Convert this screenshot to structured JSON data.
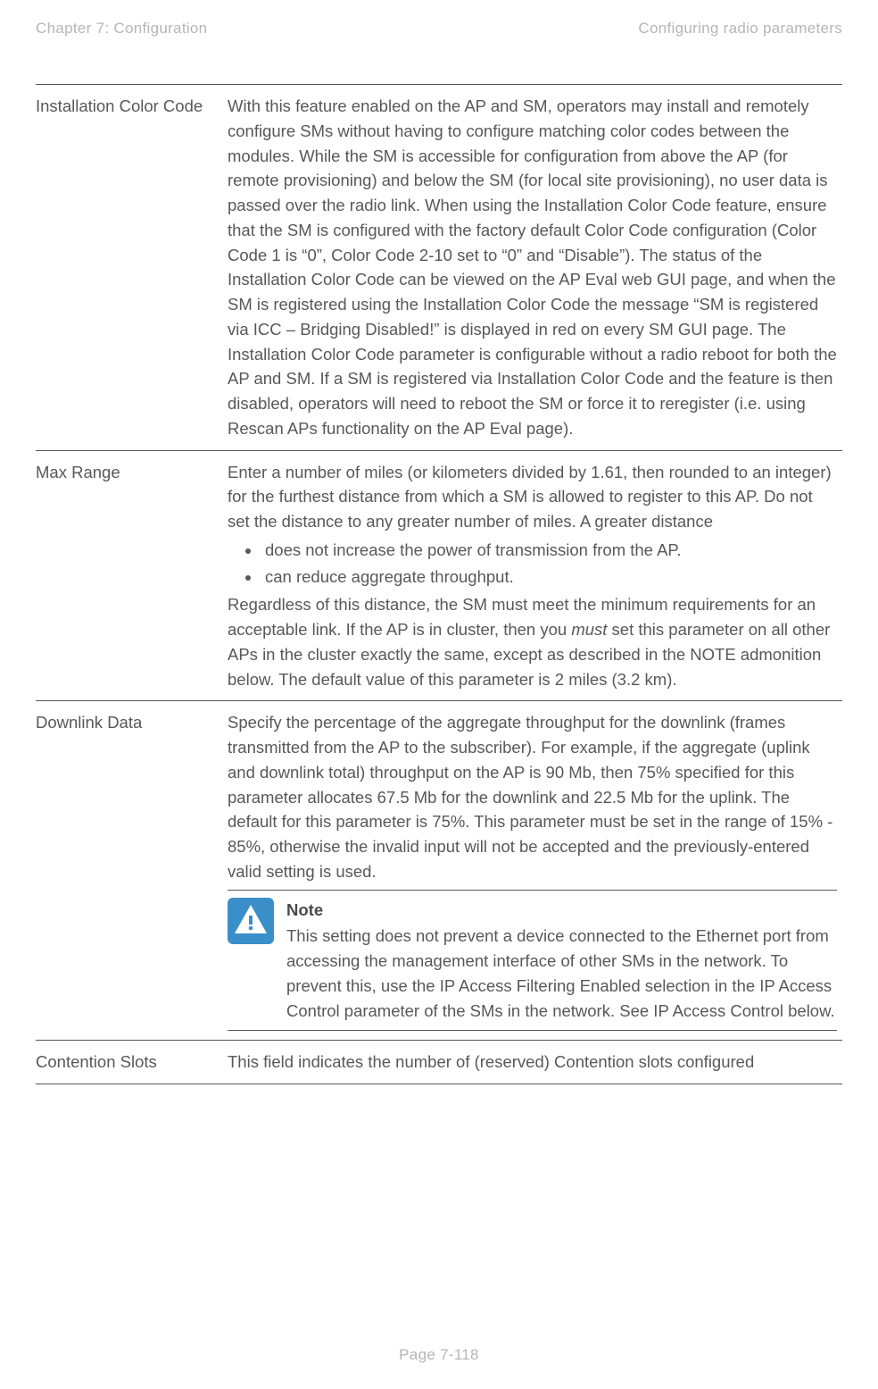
{
  "header": {
    "left": "Chapter 7:  Configuration",
    "right": "Configuring radio parameters"
  },
  "rows": {
    "installation_color_code": {
      "label": "Installation Color Code",
      "text": "With this feature enabled on the AP and SM, operators may install and remotely configure SMs without having to configure matching color codes between the modules.  While the SM is accessible for configuration from above the AP (for remote provisioning) and below the SM (for local site provisioning), no user data is passed over the radio link.  When using the Installation Color Code feature, ensure that the SM is configured with the factory default Color Code configuration (Color Code 1 is “0”, Color Code 2-10 set to “0” and “Disable”). The status of the Installation Color Code can be viewed on the AP Eval web GUI page, and when the SM is registered using the Installation Color Code the message “SM is registered via ICC – Bridging Disabled!” is displayed in red on every SM GUI page. The Installation Color Code parameter is configurable without a radio reboot for both the AP and SM. If a SM is registered via Installation Color Code and the feature is then disabled, operators will need to reboot the SM or force it to reregister (i.e. using Rescan APs functionality on the AP Eval page)."
    },
    "max_range": {
      "label": "Max Range",
      "intro": "Enter a number of miles (or kilometers divided by 1.61, then rounded to an integer) for the furthest distance from which a SM is allowed to register to this AP. Do not set the distance to any greater number of miles. A greater distance",
      "bullets": [
        "does not increase the power of transmission from the AP.",
        "can reduce aggregate throughput."
      ],
      "after_pre": "Regardless of this distance, the SM must meet the minimum requirements for an acceptable link. If the AP is in cluster, then you ",
      "after_italic": "must",
      "after_post": " set this parameter on all other APs in the cluster exactly the same, except as described in the NOTE admonition below. The default value of this parameter is 2 miles (3.2 km)."
    },
    "downlink_data": {
      "label": "Downlink Data",
      "text": "Specify the percentage of the aggregate throughput for the downlink (frames transmitted from the AP to the subscriber). For example, if the aggregate (uplink and downlink total) throughput on the AP is 90 Mb, then 75% specified for this parameter allocates 67.5 Mb for the downlink and 22.5 Mb for the uplink. The default for this parameter is 75%. This parameter must be set in the range of 15% - 85%, otherwise the invalid input will not be accepted and the previously-entered valid setting is used.",
      "note_title": "Note",
      "note_body": "This setting does not prevent a device connected to the Ethernet port from accessing the management interface of other SMs in the network. To prevent this, use the IP Access Filtering Enabled selection in the IP Access Control parameter of the SMs in the network. See IP Access Control below."
    },
    "contention_slots": {
      "label": "Contention Slots",
      "text": "This field indicates the number of (reserved) Contention slots configured"
    }
  },
  "footer": "Page 7-118"
}
